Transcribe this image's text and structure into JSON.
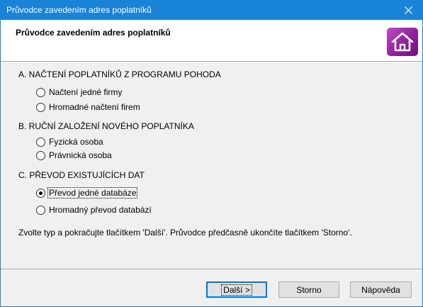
{
  "window": {
    "title": "Průvodce zavedením adres poplatníků",
    "close_icon": "close-icon"
  },
  "header": {
    "title": "Průvodce zavedením adres poplatníků",
    "logo_icon": "home-icon",
    "logo_color": "#a22fad"
  },
  "sections": [
    {
      "heading": "A. NAČTENÍ POPLATNÍKŮ Z PROGRAMU POHODA",
      "options": [
        {
          "label": "Načtení jedné firmy",
          "checked": false
        },
        {
          "label": "Hromadné načtení firem",
          "checked": false
        }
      ]
    },
    {
      "heading": "B. RUČNÍ ZALOŽENÍ NOVÉHO POPLATNÍKA",
      "options": [
        {
          "label": "Fyzická osoba",
          "checked": false
        },
        {
          "label": "Právnická osoba",
          "checked": false
        }
      ]
    },
    {
      "heading": "C. PŘEVOD EXISTUJÍCÍCH DAT",
      "options": [
        {
          "label": "Převod jedné databáze",
          "checked": true
        },
        {
          "label": "Hromadný převod databází",
          "checked": false
        }
      ]
    }
  ],
  "hint": "Zvolte typ a pokračujte tlačítkem 'Další'. Průvodce předčasně ukončíte tlačítkem 'Storno'.",
  "buttons": {
    "next": "Další >",
    "cancel": "Storno",
    "help": "Nápověda"
  },
  "colors": {
    "titlebar": "#1883d7",
    "accent": "#0078d7"
  }
}
